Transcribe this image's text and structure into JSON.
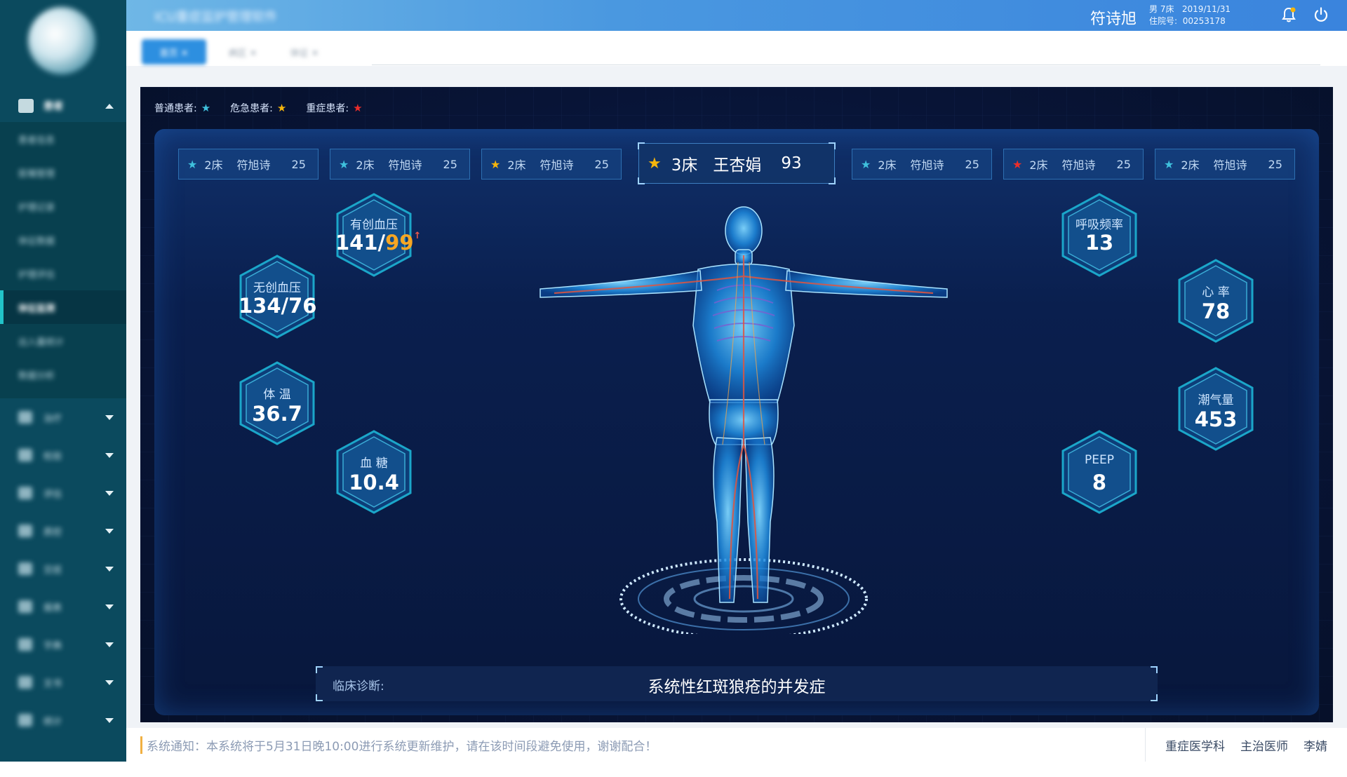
{
  "header": {
    "system_title": "ICU重症监护管理软件",
    "user_name": "符诗旭",
    "gender_bed": "男 7床",
    "date": "2019/11/31",
    "admission_label": "住院号:",
    "admission_no": "00253178"
  },
  "tabs": [
    {
      "label": "首页 ✕"
    },
    {
      "label": "病区 ✕"
    },
    {
      "label": "体征 ✕"
    }
  ],
  "sidebar": {
    "group": {
      "label": "患者",
      "items": [
        "患者信息",
        "医嘱管理",
        "护理记录",
        "体征数据",
        "护理评估",
        "体征监测",
        "出入量统计",
        "数据分析"
      ],
      "active_index": 5
    },
    "menu": [
      {
        "label": "治疗"
      },
      {
        "label": "检验"
      },
      {
        "label": "评估"
      },
      {
        "label": "质控"
      },
      {
        "label": "交班"
      },
      {
        "label": "报表"
      },
      {
        "label": "字典"
      },
      {
        "label": "文书"
      },
      {
        "label": "统计"
      }
    ]
  },
  "legend": [
    {
      "label": "普通患者:",
      "color": "#3fc1dd",
      "icon": "star-icon"
    },
    {
      "label": "危急患者:",
      "color": "#f5b50c",
      "icon": "star-icon"
    },
    {
      "label": "重症患者:",
      "color": "#ec2d2a",
      "icon": "star-icon"
    }
  ],
  "patients_left": [
    {
      "bed": "2床",
      "name": "符旭诗",
      "score": "25",
      "color": "#3fc1dd"
    },
    {
      "bed": "2床",
      "name": "符旭诗",
      "score": "25",
      "color": "#3fc1dd"
    },
    {
      "bed": "2床",
      "name": "符旭诗",
      "score": "25",
      "color": "#f5b50c"
    }
  ],
  "patient_current": {
    "bed": "3床",
    "name": "王杏娟",
    "score": "93",
    "color": "#f5b50c"
  },
  "patients_right": [
    {
      "bed": "2床",
      "name": "符旭诗",
      "score": "25",
      "color": "#3fc1dd"
    },
    {
      "bed": "2床",
      "name": "符旭诗",
      "score": "25",
      "color": "#ec2d2a"
    },
    {
      "bed": "2床",
      "name": "符旭诗",
      "score": "25",
      "color": "#3fc1dd"
    }
  ],
  "vitals": {
    "invasive_bp": {
      "label": "有创血压",
      "value_main": "141/",
      "value_high": "99",
      "arrow": "↑"
    },
    "noninvasive_bp": {
      "label": "无创血压",
      "value": "134/76"
    },
    "temperature": {
      "label": "体 温",
      "value": "36.7"
    },
    "blood_sugar": {
      "label": "血 糖",
      "value": "10.4"
    },
    "respiratory_rate": {
      "label": "呼吸频率",
      "value": "13"
    },
    "heart_rate": {
      "label": "心 率",
      "value": "78"
    },
    "tidal_volume": {
      "label": "潮气量",
      "value": "453"
    },
    "peep": {
      "label": "PEEP",
      "value": "8"
    }
  },
  "diagnosis": {
    "label": "临床诊断:",
    "text": "系统性红斑狼疮的并发症"
  },
  "footer": {
    "notice": "系统通知：本系统将于5月31日晚10:00进行系统更新维护，请在该时间段避免使用，谢谢配合！",
    "department": "重症医学科",
    "role": "主治医师",
    "doctor": "李婧"
  }
}
